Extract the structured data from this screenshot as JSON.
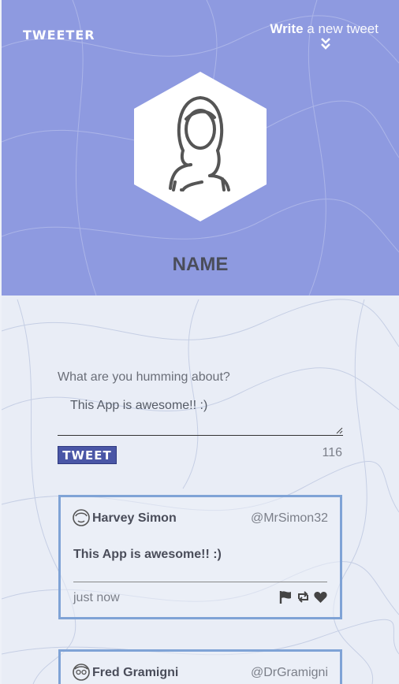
{
  "header": {
    "brand": "TWEETER",
    "write_bold": "Write",
    "write_rest": "a new tweet",
    "name": "NAME"
  },
  "composer": {
    "prompt": "What are you humming about?",
    "value": "This App is awesome!! :)",
    "button_label": "TWEET",
    "char_count": "116"
  },
  "tweets": [
    {
      "user": "Harvey Simon",
      "handle": "@MrSimon32",
      "text": "This App is awesome!! :)",
      "time": "just now"
    },
    {
      "user": "Fred Gramigni",
      "handle": "@DrGramigni"
    }
  ],
  "colors": {
    "header_bg": "#8e9ae0",
    "button_bg": "#4a56a6",
    "card_border": "#7fa3d6"
  }
}
